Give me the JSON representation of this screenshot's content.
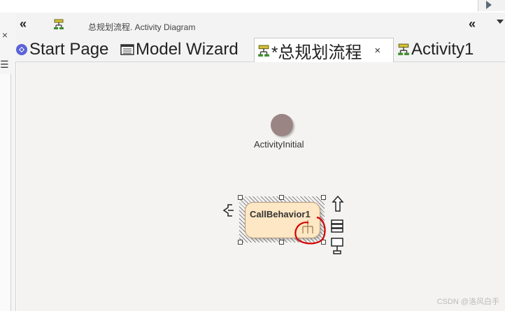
{
  "window": {
    "left_close_icon": "×",
    "left_menu_icon": "☰"
  },
  "title_bar": {
    "collapse_left": "«",
    "collapse_right": "«",
    "text": "总规划流程.  Activity Diagram"
  },
  "tabs": [
    {
      "label": "Start Page",
      "icon": "start-page-icon"
    },
    {
      "label": "Model Wizard",
      "icon": "model-wizard-icon"
    },
    {
      "label": "*总规划流程",
      "icon": "activity-diagram-icon",
      "active": true,
      "close": "×"
    },
    {
      "label": "Activity1",
      "icon": "activity-diagram-icon"
    }
  ],
  "diagram": {
    "initial_node_label": "ActivityInitial",
    "action_label": "CallBehavior1",
    "colors": {
      "initial_node": "#9a8584",
      "action_fill": "#fde7c4",
      "annotation": "#d40000",
      "canvas": "#f4f3f2"
    }
  },
  "watermark": "CSDN @洛风白手"
}
